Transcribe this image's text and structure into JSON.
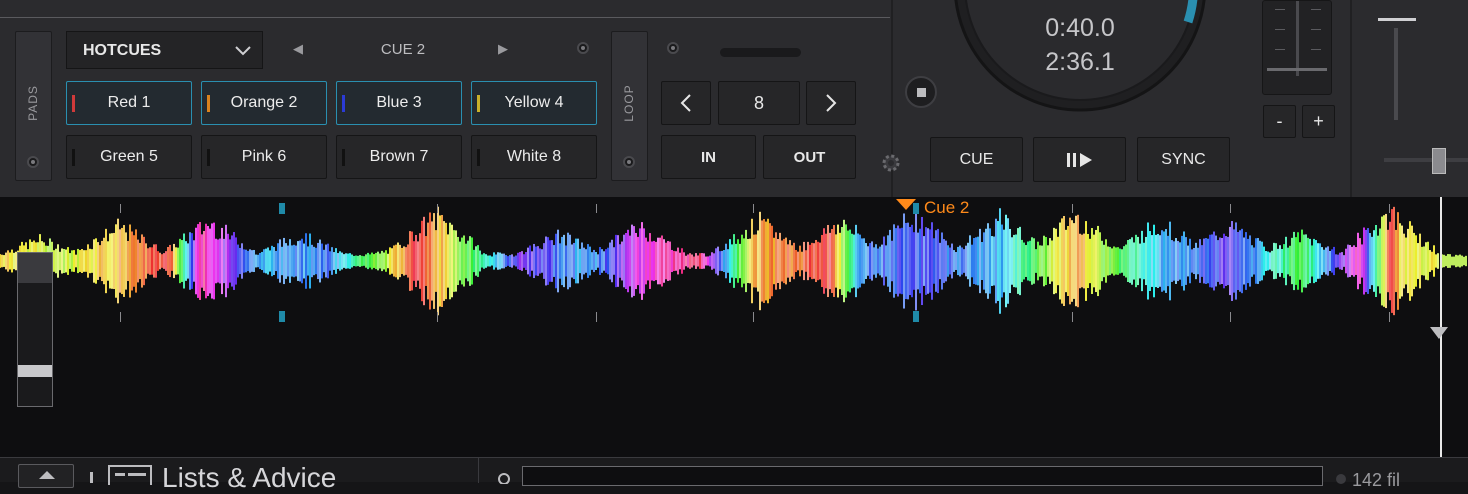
{
  "pads": {
    "side_label": "PADS",
    "mode_dropdown": "HOTCUES",
    "page_label": "CUE 2",
    "hotcues": [
      {
        "label": "Red 1",
        "color": "#d03a3a",
        "active": true
      },
      {
        "label": "Orange 2",
        "color": "#d9821e",
        "active": true
      },
      {
        "label": "Blue 3",
        "color": "#2b3bd6",
        "active": true
      },
      {
        "label": "Yellow 4",
        "color": "#c9b02a",
        "active": true
      },
      {
        "label": "Green 5",
        "color": "#111111",
        "active": false
      },
      {
        "label": "Pink 6",
        "color": "#111111",
        "active": false
      },
      {
        "label": "Brown 7",
        "color": "#111111",
        "active": false
      },
      {
        "label": "White 8",
        "color": "#111111",
        "active": false
      }
    ]
  },
  "loop": {
    "side_label": "LOOP",
    "size_value": "8",
    "in_label": "IN",
    "out_label": "OUT"
  },
  "transport": {
    "cue_label": "CUE",
    "play_pause_icon": "play-pause-icon",
    "sync_label": "SYNC"
  },
  "jog": {
    "elapsed": "0:40.0",
    "remaining": "2:36.1"
  },
  "pitch": {
    "minus_label": "-",
    "plus_label": "+"
  },
  "waveform": {
    "cue_marker_label": "Cue 2",
    "cue_marker_color": "#ff8a1a",
    "playhead_color": "#ffffff",
    "beat_marker_color": "#1f8aa8"
  },
  "bottom": {
    "section_title": "Lists & Advice",
    "file_count": "142 fil"
  }
}
